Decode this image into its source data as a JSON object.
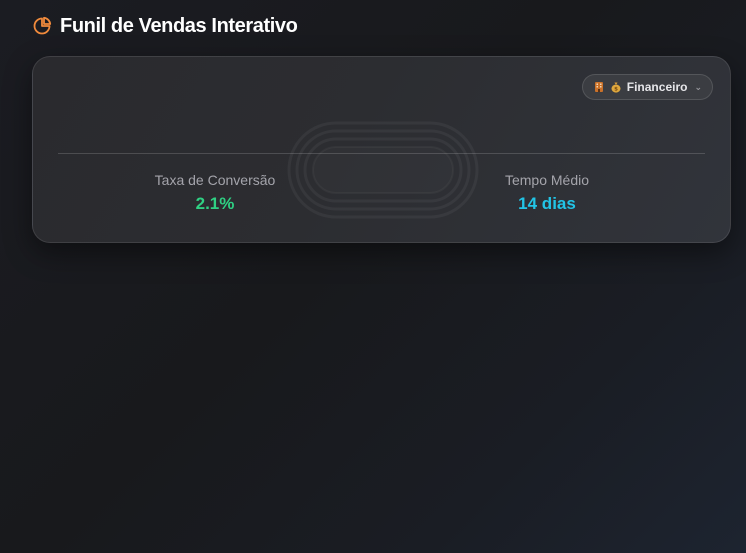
{
  "header": {
    "title": "Funil de Vendas Interativo",
    "icon": "pie-chart-icon",
    "icon_color": "#f08a3c"
  },
  "filter": {
    "selected": "Financeiro",
    "icons": [
      "building-icon",
      "money-bag-icon"
    ]
  },
  "stats": {
    "conversion": {
      "label": "Taxa de Conversão",
      "value": "2.1%",
      "color": "#2fd083"
    },
    "time": {
      "label": "Tempo Médio",
      "value": "14 dias",
      "color": "#22c4e6"
    }
  }
}
